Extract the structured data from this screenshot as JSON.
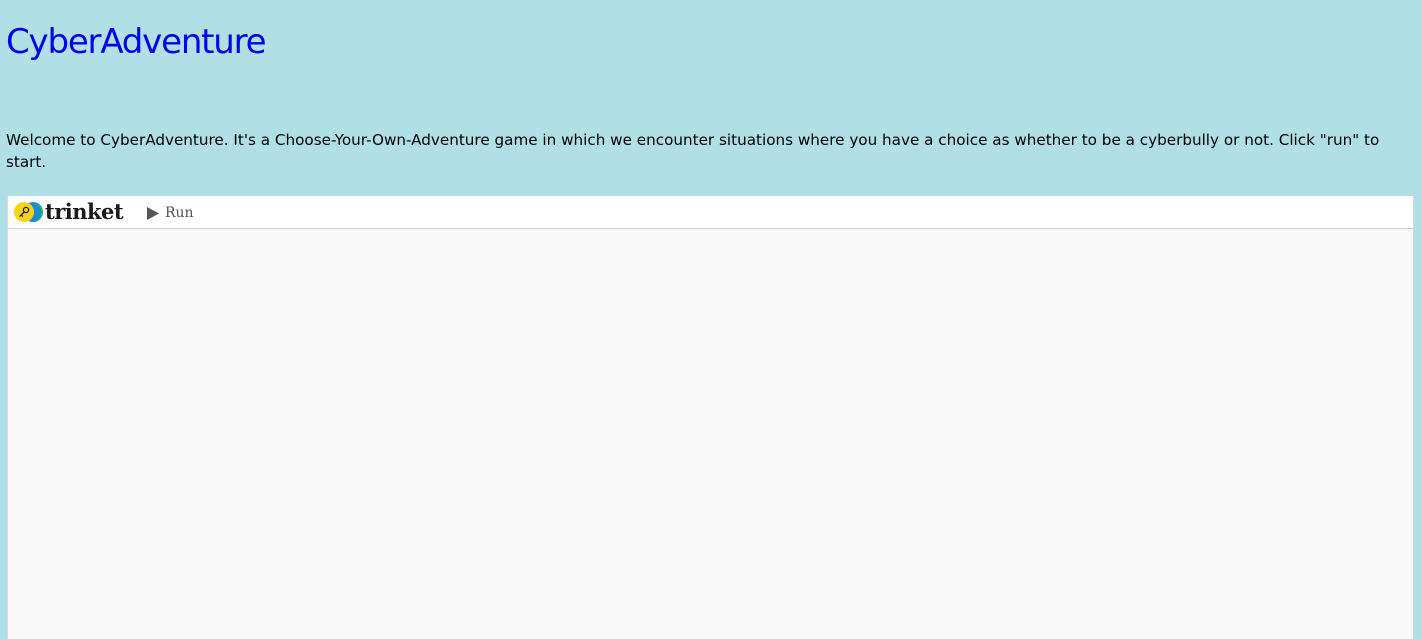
{
  "page": {
    "title": "CyberAdventure",
    "intro": "Welcome to CyberAdventure. It's a Choose-Your-Own-Adventure game in which we encounter situations where you have a choice as whether to be a cyberbully or not. Click \"run\" to start."
  },
  "embed": {
    "brand_name": "trinket",
    "brand_icon": "trinket-logo-icon",
    "run_icon": "play-icon",
    "run_label": "Run"
  },
  "colors": {
    "page_background": "#b0dfe5",
    "title": "#0000ee",
    "embed_background": "#f8f8f8",
    "toolbar_background": "#ffffff",
    "logo_yellow": "#f7d417",
    "logo_blue": "#1e8bd3",
    "logo_green": "#23b36b"
  }
}
